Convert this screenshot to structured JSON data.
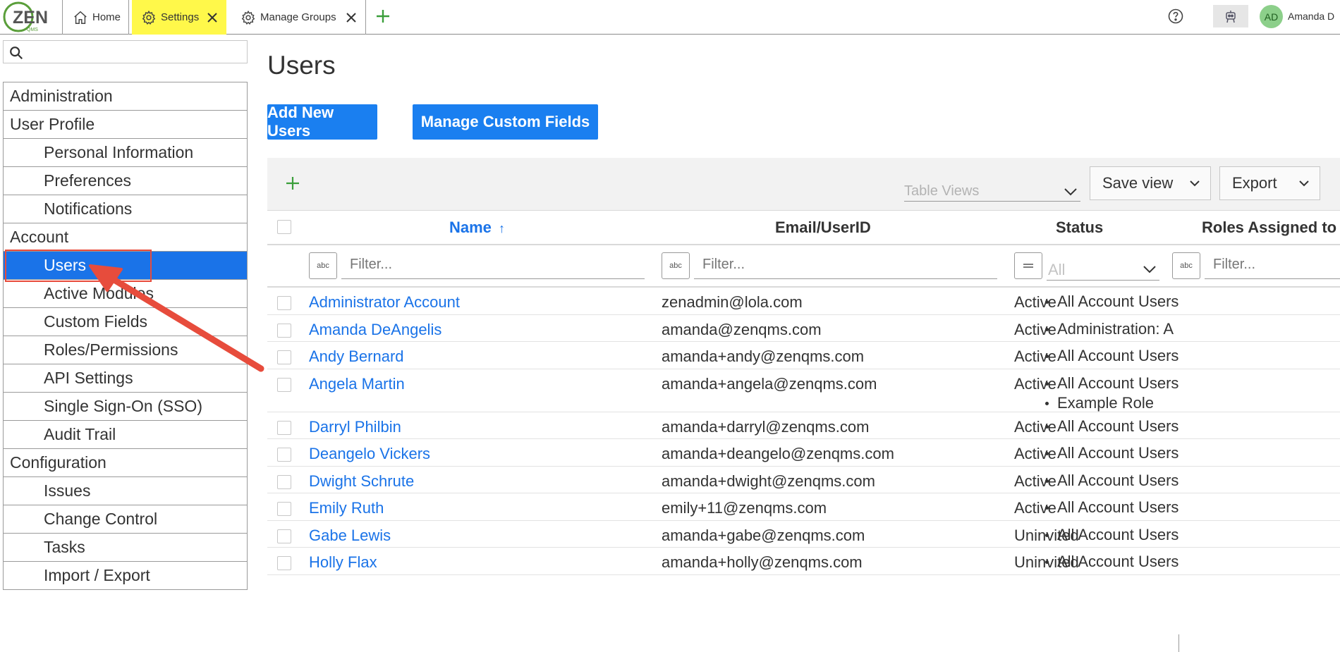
{
  "app": {
    "logo_text": "ZEN",
    "logo_subtext": "QMS"
  },
  "tabs": [
    {
      "label": "Home",
      "icon": "home-icon"
    },
    {
      "label": "Settings",
      "icon": "gear-icon"
    },
    {
      "label": "Manage Groups",
      "icon": "gear-icon"
    }
  ],
  "header": {
    "user_initials": "AD",
    "user_name": "Amanda D"
  },
  "sidebar": {
    "search_placeholder": "",
    "items": [
      {
        "label": "Administration",
        "level": "section"
      },
      {
        "label": "User Profile",
        "level": "section"
      },
      {
        "label": "Personal Information",
        "level": "sub"
      },
      {
        "label": "Preferences",
        "level": "sub"
      },
      {
        "label": "Notifications",
        "level": "sub"
      },
      {
        "label": "Account",
        "level": "section"
      },
      {
        "label": "Users",
        "level": "sub",
        "active": true
      },
      {
        "label": "Active Modules",
        "level": "sub"
      },
      {
        "label": "Custom Fields",
        "level": "sub"
      },
      {
        "label": "Roles/Permissions",
        "level": "sub"
      },
      {
        "label": "API Settings",
        "level": "sub"
      },
      {
        "label": "Single Sign-On (SSO)",
        "level": "sub"
      },
      {
        "label": "Audit Trail",
        "level": "sub"
      },
      {
        "label": "Configuration",
        "level": "section"
      },
      {
        "label": "Issues",
        "level": "sub"
      },
      {
        "label": "Change Control",
        "level": "sub"
      },
      {
        "label": "Tasks",
        "level": "sub"
      },
      {
        "label": "Import / Export",
        "level": "sub"
      }
    ]
  },
  "main": {
    "title": "Users",
    "add_users_label": "Add New Users",
    "manage_fields_label": "Manage Custom Fields",
    "table_views_placeholder": "Table Views",
    "save_view_label": "Save view",
    "export_label": "Export",
    "columns": {
      "name": "Name",
      "email": "Email/UserID",
      "status": "Status",
      "roles": "Roles Assigned to"
    },
    "filter_placeholder": "Filter...",
    "status_filter_value": "All",
    "filter_type_text": "abc",
    "sort_indicator": "↑"
  },
  "users": [
    {
      "name": "Administrator Account",
      "email": "zenadmin@lola.com",
      "status": "Active",
      "roles": [
        "All Account Users"
      ]
    },
    {
      "name": "Amanda DeAngelis",
      "email": "amanda@zenqms.com",
      "status": "Active",
      "roles": [
        "Administration: A"
      ]
    },
    {
      "name": "Andy Bernard",
      "email": "amanda+andy@zenqms.com",
      "status": "Active",
      "roles": [
        "All Account Users"
      ]
    },
    {
      "name": "Angela Martin",
      "email": "amanda+angela@zenqms.com",
      "status": "Active",
      "roles": [
        "All Account Users",
        "Example Role"
      ]
    },
    {
      "name": "Darryl Philbin",
      "email": "amanda+darryl@zenqms.com",
      "status": "Active",
      "roles": [
        "All Account Users"
      ]
    },
    {
      "name": "Deangelo Vickers",
      "email": "amanda+deangelo@zenqms.com",
      "status": "Active",
      "roles": [
        "All Account Users"
      ]
    },
    {
      "name": "Dwight Schrute",
      "email": "amanda+dwight@zenqms.com",
      "status": "Active",
      "roles": [
        "All Account Users"
      ]
    },
    {
      "name": "Emily Ruth",
      "email": "emily+11@zenqms.com",
      "status": "Active",
      "roles": [
        "All Account Users"
      ]
    },
    {
      "name": "Gabe Lewis",
      "email": "amanda+gabe@zenqms.com",
      "status": "Uninvited",
      "roles": [
        "All Account Users"
      ]
    },
    {
      "name": "Holly Flax",
      "email": "amanda+holly@zenqms.com",
      "status": "Uninvited",
      "roles": [
        "All Account Users"
      ]
    }
  ],
  "colors": {
    "accent": "#1a73e8",
    "button": "#1a7ff0",
    "highlight_tab": "#fff84a",
    "annotation": "#e74c3c",
    "logo_green": "#5a9e3a"
  }
}
